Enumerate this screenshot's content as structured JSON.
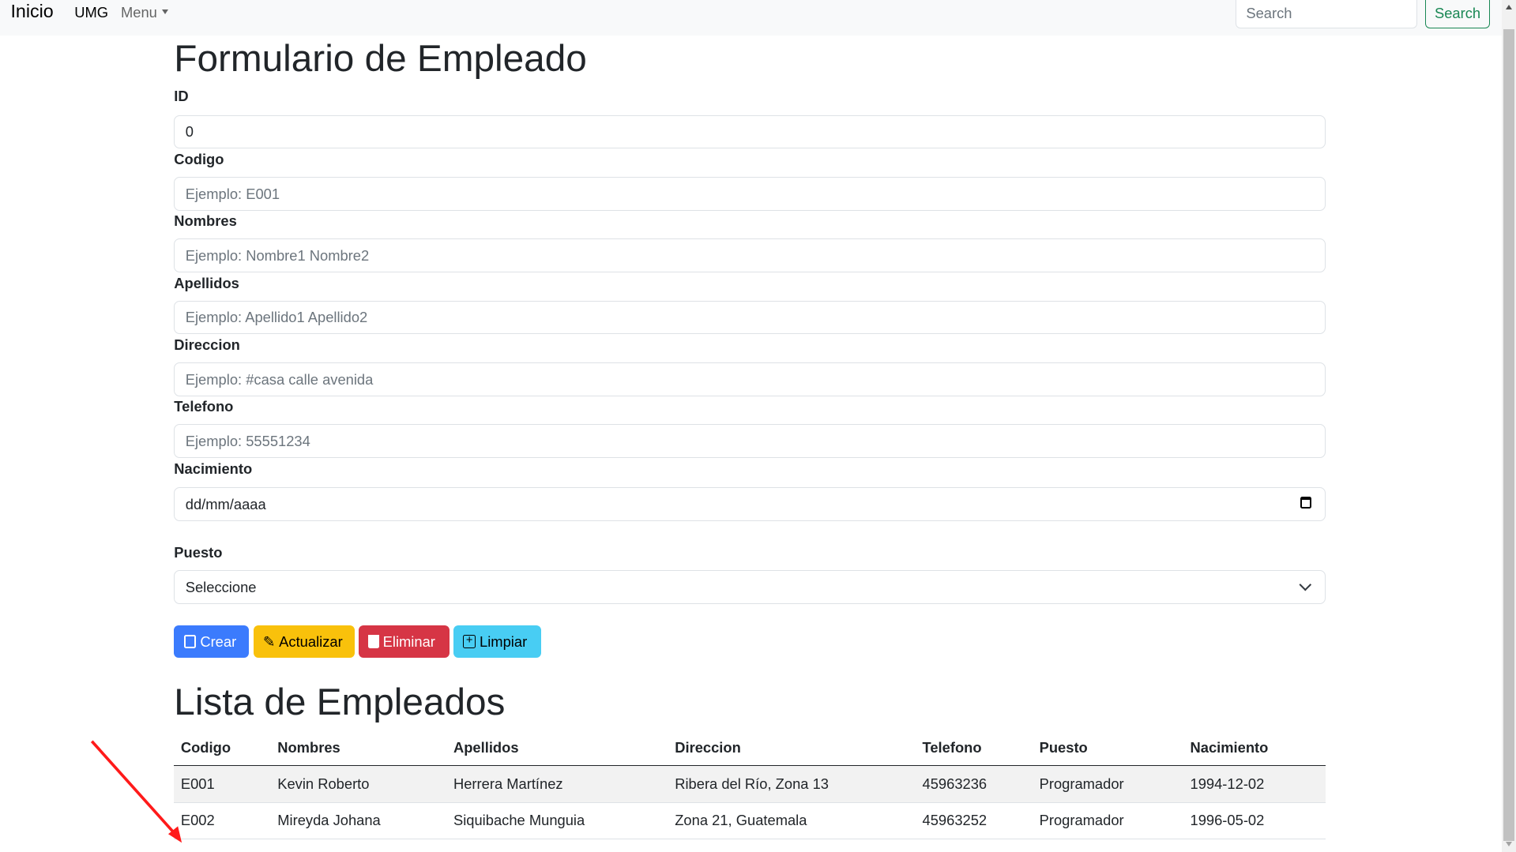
{
  "navbar": {
    "brand": "Inicio",
    "links": [
      "UMG",
      "Menu"
    ],
    "search_placeholder": "Search",
    "search_button": "Search"
  },
  "form": {
    "title": "Formulario de Empleado",
    "fields": [
      {
        "label": "ID",
        "value": "0"
      },
      {
        "label": "Codigo",
        "placeholder": "Ejemplo: E001"
      },
      {
        "label": "Nombres",
        "placeholder": "Ejemplo: Nombre1 Nombre2"
      },
      {
        "label": "Apellidos",
        "placeholder": "Ejemplo: Apellido1 Apellido2"
      },
      {
        "label": "Direccion",
        "placeholder": "Ejemplo: #casa calle avenida"
      },
      {
        "label": "Telefono",
        "placeholder": "Ejemplo: 55551234"
      },
      {
        "label": "Nacimiento",
        "value": "dd/mm/aaaa"
      },
      {
        "label": "Puesto",
        "value": "Seleccione"
      }
    ],
    "buttons": {
      "crear": "Crear",
      "actualizar": "Actualizar",
      "eliminar": "Eliminar",
      "limpiar": "Limpiar"
    },
    "colors": {
      "primary": "#3b7bfd",
      "warning": "#f9c10b",
      "danger": "#d63545",
      "info": "#48cdf3"
    }
  },
  "list": {
    "title": "Lista de Empleados",
    "headers": [
      "Codigo",
      "Nombres",
      "Apellidos",
      "Direccion",
      "Telefono",
      "Puesto",
      "Nacimiento"
    ],
    "rows": [
      [
        "E001",
        "Kevin Roberto",
        "Herrera Martínez",
        "Ribera del Río, Zona 13",
        "45963236",
        "Programador",
        "1994-12-02"
      ],
      [
        "E002",
        "Mireyda Johana",
        "Siquibache Munguia",
        "Zona 21, Guatemala",
        "45963252",
        "Programador",
        "1996-05-02"
      ]
    ]
  }
}
